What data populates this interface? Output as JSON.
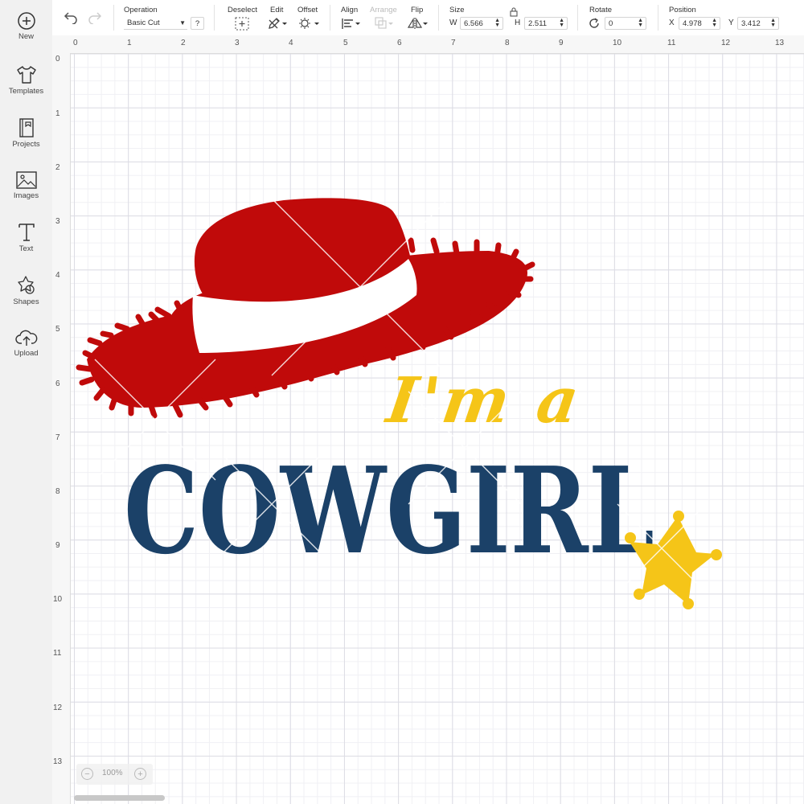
{
  "sidebar": {
    "items": [
      {
        "label": "New",
        "icon": "plus-circle-icon"
      },
      {
        "label": "Templates",
        "icon": "tshirt-icon"
      },
      {
        "label": "Projects",
        "icon": "notebook-icon"
      },
      {
        "label": "Images",
        "icon": "image-icon"
      },
      {
        "label": "Text",
        "icon": "text-t-icon"
      },
      {
        "label": "Shapes",
        "icon": "shapes-icon"
      },
      {
        "label": "Upload",
        "icon": "cloud-upload-icon"
      }
    ]
  },
  "toolbar": {
    "operation_label": "Operation",
    "operation_value": "Basic Cut",
    "help_label": "?",
    "deselect_label": "Deselect",
    "edit_label": "Edit",
    "offset_label": "Offset",
    "align_label": "Align",
    "arrange_label": "Arrange",
    "flip_label": "Flip",
    "size_label": "Size",
    "width_letter": "W",
    "width_value": "6.566",
    "height_letter": "H",
    "height_value": "2.511",
    "rotate_label": "Rotate",
    "rotate_value": "0",
    "position_label": "Position",
    "x_letter": "X",
    "x_value": "4.978",
    "y_letter": "Y",
    "y_value": "3.412"
  },
  "ruler": {
    "top": [
      "0",
      "1",
      "2",
      "3",
      "4",
      "5",
      "6",
      "7",
      "8",
      "9",
      "10",
      "11",
      "12",
      "13"
    ],
    "left": [
      "0",
      "1",
      "2",
      "3",
      "4",
      "5",
      "6",
      "7",
      "8",
      "9",
      "10",
      "11",
      "12",
      "13"
    ]
  },
  "design": {
    "line1": "I'm a",
    "line2": "COWGIRL",
    "colors": {
      "hat": "#c00a0a",
      "band": "#ffffff",
      "script": "#f5c518",
      "cowgirl": "#1b4168",
      "star": "#f5c518"
    }
  },
  "zoom": {
    "value": "100%",
    "minus": "−",
    "plus": "+"
  }
}
